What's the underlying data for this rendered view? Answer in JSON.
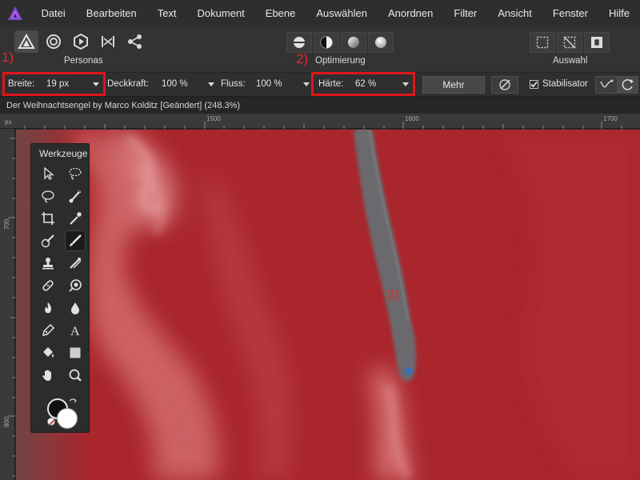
{
  "menu": [
    "Datei",
    "Bearbeiten",
    "Text",
    "Dokument",
    "Ebene",
    "Auswählen",
    "Anordnen",
    "Filter",
    "Ansicht",
    "Fenster",
    "Hilfe"
  ],
  "toolbar": {
    "personas_label": "Personas",
    "optimierung_label": "Optimierung",
    "auswahl_label": "Auswahl",
    "persona_icons": [
      "photo-persona-icon",
      "liquify-persona-icon",
      "develop-persona-icon",
      "tone-mapping-persona-icon",
      "export-persona-icon"
    ],
    "optimierung_icons": [
      "boolean-icon",
      "contrast-icon",
      "gradient-sphere-icon",
      "sphere-icon"
    ],
    "auswahl_icons": [
      "marquee-icon",
      "deselect-icon",
      "invert-selection-icon"
    ]
  },
  "annotations": {
    "one": "1)",
    "two": "2)",
    "three": "3)"
  },
  "context": {
    "breite_label": "Breite:",
    "breite_value": "19 px",
    "deckkraft_label": "Deckkraft:",
    "deckkraft_value": "100 %",
    "fluss_label": "Fluss:",
    "fluss_value": "100 %",
    "haerte_label": "Härte:",
    "haerte_value": "62 %",
    "mehr_label": "Mehr",
    "stabilisator_label": "Stabilisator",
    "stabilisator_checked": true
  },
  "document": {
    "title": "Der Weihnachtsengel by Marco Kolditz [Geändert] (248.3%)"
  },
  "rulers": {
    "unit": "px",
    "top_ticks": [
      "1500",
      "1600",
      "1700"
    ],
    "left_ticks": [
      "700",
      "800"
    ]
  },
  "tools_panel": {
    "title": "Werkzeuge",
    "tools": [
      "move-tool-icon",
      "freehand-selection-icon",
      "lasso-selection-icon",
      "selection-brush-icon",
      "crop-tool-icon",
      "color-picker-icon",
      "mask-brush-icon",
      "paint-brush-icon",
      "clone-stamp-icon",
      "paint-mixer-icon",
      "healing-brush-icon",
      "dodge-burn-icon",
      "burn-tool-icon",
      "blur-drop-icon",
      "pen-tool-icon",
      "text-tool-icon",
      "fill-bucket-icon",
      "rectangle-tool-icon",
      "hand-tool-icon",
      "zoom-tool-icon"
    ],
    "active_tool": "paint-brush-icon"
  },
  "colors": {
    "mask_red": "#a92a30",
    "annotation_red": "#e0141b",
    "app_logo_purple": "#7c4bd6",
    "primary_color": "#111111",
    "secondary_color": "#ffffff"
  }
}
